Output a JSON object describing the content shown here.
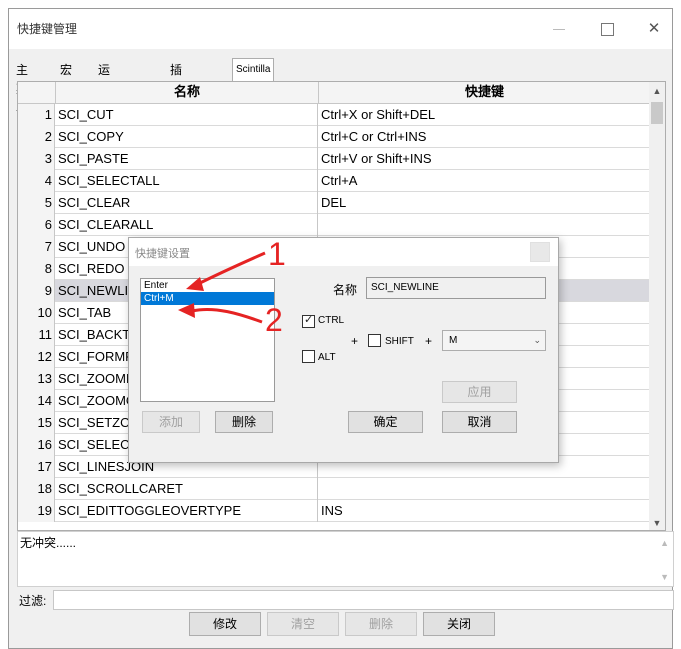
{
  "window": {
    "title": "快捷键管理",
    "minimize_glyph": "—",
    "close_glyph": "✕"
  },
  "tabs": [
    {
      "label": "主菜单"
    },
    {
      "label": "宏"
    },
    {
      "label": "运行命令"
    },
    {
      "label": "插件命令"
    },
    {
      "label": "Scintilla命令"
    }
  ],
  "table": {
    "col_name": "名称",
    "col_key": "快捷键",
    "rows": [
      {
        "num": "1",
        "name": "SCI_CUT",
        "key": "Ctrl+X or Shift+DEL"
      },
      {
        "num": "2",
        "name": "SCI_COPY",
        "key": "Ctrl+C or Ctrl+INS"
      },
      {
        "num": "3",
        "name": "SCI_PASTE",
        "key": "Ctrl+V or Shift+INS"
      },
      {
        "num": "4",
        "name": "SCI_SELECTALL",
        "key": "Ctrl+A"
      },
      {
        "num": "5",
        "name": "SCI_CLEAR",
        "key": "DEL"
      },
      {
        "num": "6",
        "name": "SCI_CLEARALL",
        "key": ""
      },
      {
        "num": "7",
        "name": "SCI_UNDO",
        "key": ""
      },
      {
        "num": "8",
        "name": "SCI_REDO",
        "key": ""
      },
      {
        "num": "9",
        "name": "SCI_NEWLIN",
        "key": ""
      },
      {
        "num": "10",
        "name": "SCI_TAB",
        "key": ""
      },
      {
        "num": "11",
        "name": "SCI_BACKTA",
        "key": ""
      },
      {
        "num": "12",
        "name": "SCI_FORMFI",
        "key": ""
      },
      {
        "num": "13",
        "name": "SCI_ZOOMIN",
        "key": ""
      },
      {
        "num": "14",
        "name": "SCI_ZOOMO",
        "key": ""
      },
      {
        "num": "15",
        "name": "SCI_SETZOC",
        "key": ""
      },
      {
        "num": "16",
        "name": "SCI_SELECT",
        "key": ""
      },
      {
        "num": "17",
        "name": "SCI_LINESJOIN",
        "key": ""
      },
      {
        "num": "18",
        "name": "SCI_SCROLLCARET",
        "key": ""
      },
      {
        "num": "19",
        "name": "SCI_EDITTOGGLEOVERTYPE",
        "key": "INS"
      }
    ],
    "selected_row": 9
  },
  "conflict": {
    "text": "无冲突......"
  },
  "filter": {
    "label": "过滤:",
    "value": ""
  },
  "buttons": {
    "modify": "修改",
    "clear": "清空",
    "delete": "删除",
    "close": "关闭"
  },
  "dialog": {
    "title": "快捷键设置",
    "shortcuts": [
      "Enter",
      "Ctrl+M"
    ],
    "selected_shortcut": 1,
    "name_label": "名称",
    "name_value": "SCI_NEWLINE",
    "ctrl_label": "CTRL",
    "ctrl_checked": true,
    "alt_label": "ALT",
    "alt_checked": false,
    "shift_label": "SHIFT",
    "shift_checked": false,
    "plus1": "+",
    "plus2": "+",
    "key_value": "M",
    "add": "添加",
    "remove": "删除",
    "apply": "应用",
    "ok": "确定",
    "cancel": "取消"
  },
  "annotations": {
    "arrow1_number": "1",
    "arrow2_number": "2",
    "color": "#e52323"
  },
  "colors": {
    "selection_blue": "#0078d7",
    "selected_row_gray": "#d8d8de"
  }
}
